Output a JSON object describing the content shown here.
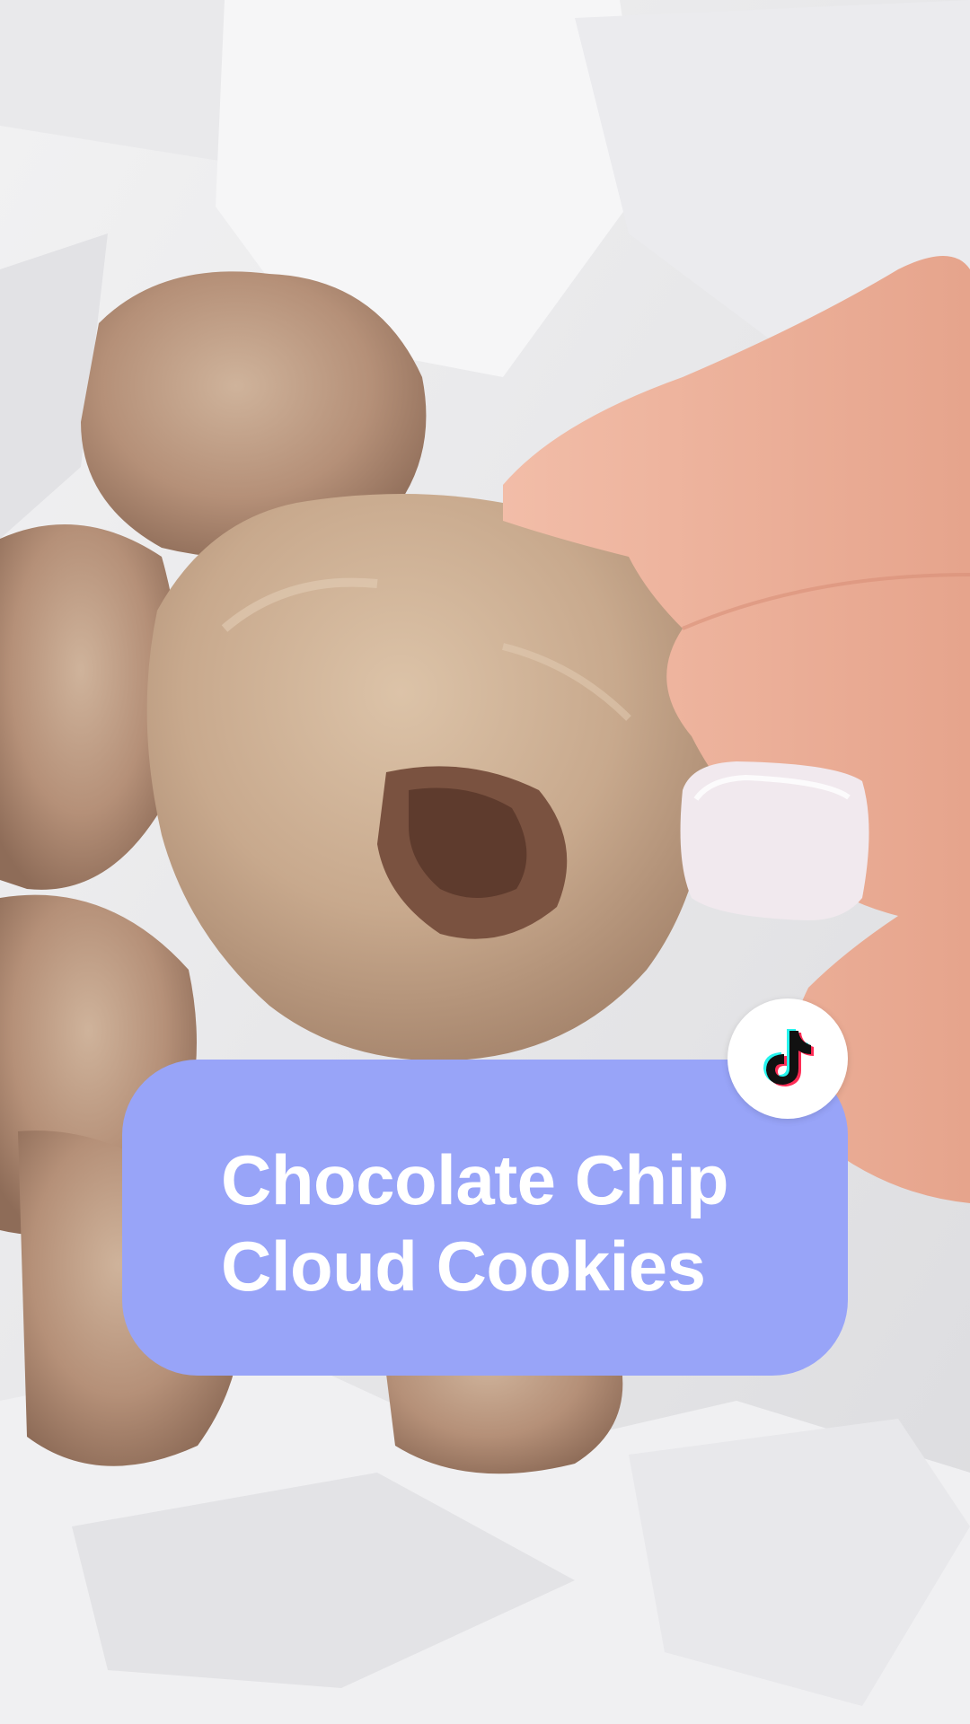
{
  "overlay": {
    "title_line_1": "Chocolate Chip",
    "title_line_2": "Cloud Cookies"
  },
  "badge": {
    "icon": "tiktok-logo-icon"
  },
  "colors": {
    "card": "#98a4f8",
    "title_text": "#ffffff",
    "badge_bg": "#ffffff",
    "logo": "#111111"
  }
}
